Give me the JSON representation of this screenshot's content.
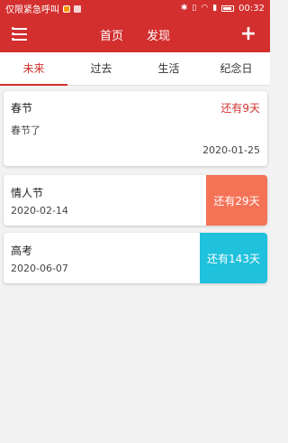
{
  "status_bar": {
    "carrier_text": "仅限紧急呼叫",
    "time": "00:32",
    "icons": [
      "notification-icon",
      "image-icon",
      "bluetooth-icon",
      "vibrate-icon",
      "wifi-icon",
      "sim-icon",
      "battery-icon"
    ]
  },
  "header": {
    "nav": [
      "首页",
      "发现"
    ],
    "menu_icon": "menu-icon",
    "add_label": "+",
    "background": "#d32f2f"
  },
  "tabs": [
    {
      "label": "未来",
      "active": true
    },
    {
      "label": "过去",
      "active": false
    },
    {
      "label": "生活",
      "active": false
    },
    {
      "label": "纪念日",
      "active": false
    }
  ],
  "events": [
    {
      "title": "春节",
      "description": "春节了",
      "remaining": "还有9天",
      "date": "2020-01-25"
    },
    {
      "title": "情人节",
      "date": "2020-02-14",
      "remaining": "还有29天",
      "badge_color": "#f47357"
    },
    {
      "title": "高考",
      "date": "2020-06-07",
      "remaining": "还有143天",
      "badge_color": "#1fc1dc"
    }
  ],
  "colors": {
    "accent": "#d32f2f",
    "background": "#f2f2f2"
  }
}
